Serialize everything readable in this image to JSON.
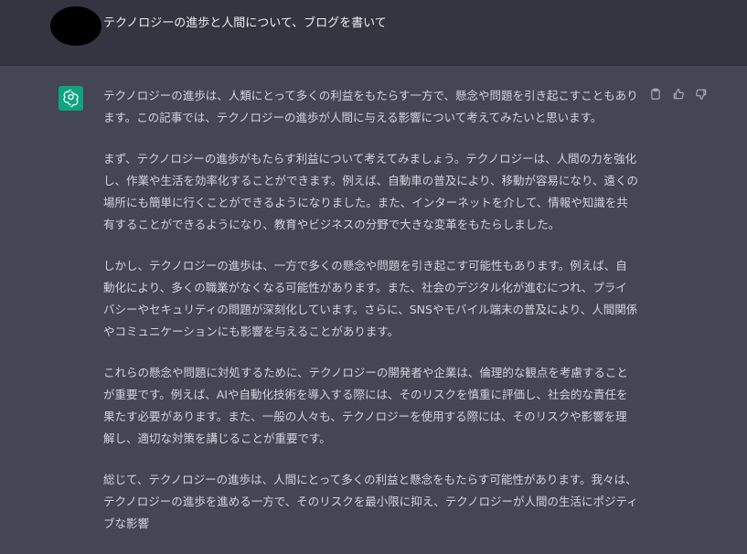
{
  "user_message": {
    "text": "テクノロジーの進歩と人間について、ブログを書いて"
  },
  "assistant_message": {
    "paragraphs": [
      "テクノロジーの進歩は、人類にとって多くの利益をもたらす一方で、懸念や問題を引き起こすこともあります。この記事では、テクノロジーの進歩が人間に与える影響について考えてみたいと思います。",
      "まず、テクノロジーの進歩がもたらす利益について考えてみましょう。テクノロジーは、人間の力を強化し、作業や生活を効率化することができます。例えば、自動車の普及により、移動が容易になり、遠くの場所にも簡単に行くことができるようになりました。また、インターネットを介して、情報や知識を共有することができるようになり、教育やビジネスの分野で大きな変革をもたらしました。",
      "しかし、テクノロジーの進歩は、一方で多くの懸念や問題を引き起こす可能性もあります。例えば、自動化により、多くの職業がなくなる可能性があります。また、社会のデジタル化が進むにつれ、プライバシーやセキュリティの問題が深刻化しています。さらに、SNSやモバイル端末の普及により、人間関係やコミュニケーションにも影響を与えることがあります。",
      "これらの懸念や問題に対処するために、テクノロジーの開発者や企業は、倫理的な観点を考慮することが重要です。例えば、AIや自動化技術を導入する際には、そのリスクを慎重に評価し、社会的な責任を果たす必要があります。また、一般の人々も、テクノロジーを使用する際には、そのリスクや影響を理解し、適切な対策を講じることが重要です。",
      "総じて、テクノロジーの進歩は、人間にとって多くの利益と懸念をもたらす可能性があります。我々は、テクノロジーの進歩を進める一方で、そのリスクを最小限に抑え、テクノロジーが人間の生活にポジティブな影響"
    ]
  },
  "icons": {
    "assistant_avatar": "openai-logo-icon",
    "copy": "clipboard-icon",
    "like": "thumbs-up-icon",
    "dislike": "thumbs-down-icon"
  },
  "colors": {
    "user_row_bg": "#343541",
    "assistant_row_bg": "#444654",
    "bot_avatar_bg": "#10a37f",
    "text": "#d1d5db"
  }
}
